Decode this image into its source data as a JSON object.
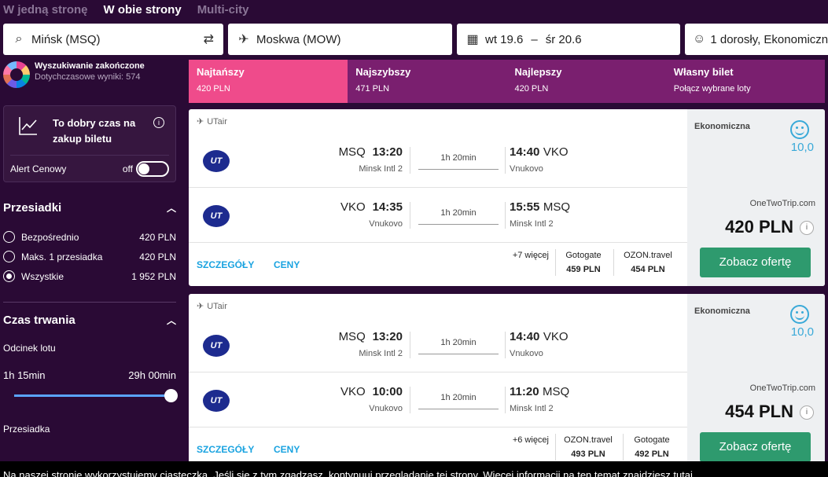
{
  "trip_tabs": [
    "W jedną stronę",
    "W obie strony",
    "Multi-city"
  ],
  "search": {
    "from": "Mińsk (MSQ)",
    "to": "Moskwa (MOW)",
    "date_out": "wt 19.6",
    "date_sep": "–",
    "date_back": "śr 20.6",
    "passengers": "1 dorosły, Ekonomiczna"
  },
  "status": {
    "title": "Wyszukiwanie zakończone",
    "subtitle": "Dotychczasowe wyniki: 574"
  },
  "alert": {
    "title": "To dobry czas na zakup biletu",
    "label": "Alert Cenowy",
    "state": "off"
  },
  "stops": {
    "title": "Przesiadki",
    "options": [
      {
        "label": "Bezpośrednio",
        "price": "420 PLN"
      },
      {
        "label": "Maks. 1 przesiadka",
        "price": "420 PLN"
      },
      {
        "label": "Wszystkie",
        "price": "1 952 PLN"
      }
    ]
  },
  "duration": {
    "title": "Czas trwania",
    "sub": "Odcinek lotu",
    "min": "1h 15min",
    "max": "29h 00min",
    "layover": "Przesiadka"
  },
  "sort_tabs": [
    {
      "name": "Najtańszy",
      "sub": "420 PLN"
    },
    {
      "name": "Najszybszy",
      "sub": "471 PLN"
    },
    {
      "name": "Najlepszy",
      "sub": "420 PLN"
    },
    {
      "name": "Własny bilet",
      "sub": "Połącz wybrane loty"
    }
  ],
  "results": [
    {
      "airline": "UTair",
      "segments": [
        {
          "dep_code": "MSQ",
          "dep_time": "13:20",
          "dep_apt": "Minsk Intl 2",
          "dur": "1h 20min",
          "arr_time": "14:40",
          "arr_code": "VKO",
          "arr_apt": "Vnukovo"
        },
        {
          "dep_code": "VKO",
          "dep_time": "14:35",
          "dep_apt": "Vnukovo",
          "dur": "1h 20min",
          "arr_time": "15:55",
          "arr_code": "MSQ",
          "arr_apt": "Minsk Intl 2"
        }
      ],
      "details": "SZCZEGÓŁY",
      "prices_link": "CENY",
      "more": "+7 więcej",
      "vendors": [
        {
          "name": "Gotogate",
          "price": "459 PLN"
        },
        {
          "name": "OZON.travel",
          "price": "454 PLN"
        }
      ],
      "cabin": "Ekonomiczna",
      "score": "10,0",
      "provider": "OneTwoTrip.com",
      "price": "420 PLN",
      "cta": "Zobacz ofertę"
    },
    {
      "airline": "UTair",
      "segments": [
        {
          "dep_code": "MSQ",
          "dep_time": "13:20",
          "dep_apt": "Minsk Intl 2",
          "dur": "1h 20min",
          "arr_time": "14:40",
          "arr_code": "VKO",
          "arr_apt": "Vnukovo"
        },
        {
          "dep_code": "VKO",
          "dep_time": "10:00",
          "dep_apt": "Vnukovo",
          "dur": "1h 20min",
          "arr_time": "11:20",
          "arr_code": "MSQ",
          "arr_apt": "Minsk Intl 2"
        }
      ],
      "details": "SZCZEGÓŁY",
      "prices_link": "CENY",
      "more": "+6 więcej",
      "vendors": [
        {
          "name": "OZON.travel",
          "price": "493 PLN"
        },
        {
          "name": "Gotogate",
          "price": "492 PLN"
        }
      ],
      "cabin": "Ekonomiczna",
      "score": "10,0",
      "provider": "OneTwoTrip.com",
      "price": "454 PLN",
      "cta": "Zobacz ofertę"
    }
  ],
  "cookie": "Na naszej stronie wykorzystujemy ciasteczka. Jeśli się z tym zgadzasz, kontynuuj przeglądanie tej strony. Więcej informacji na ten temat znajdziesz tutaj",
  "colors": {
    "bg": "#2a0a35",
    "active_tab": "#ef4b8b",
    "tab": "#7a1f6f",
    "cta": "#2e9a6e",
    "link": "#1aa3e0"
  }
}
